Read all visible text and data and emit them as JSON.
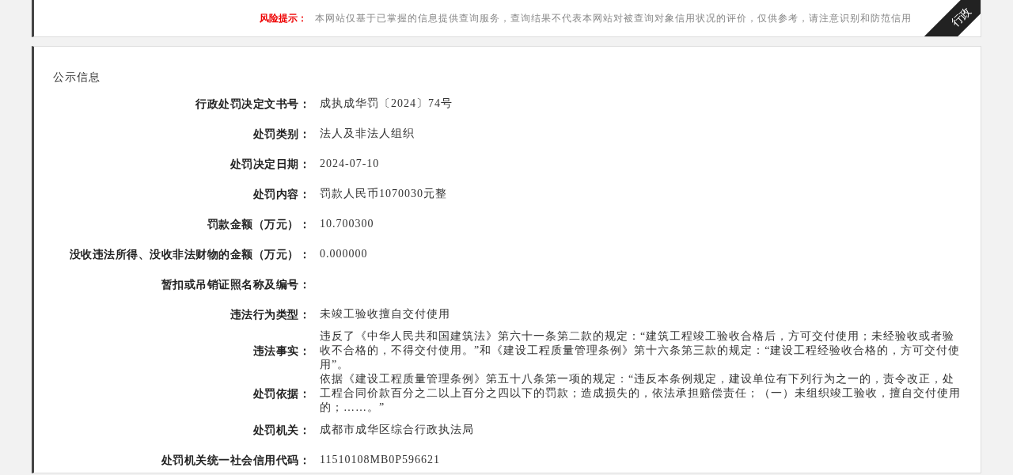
{
  "risk_notice": {
    "label": "风险提示：",
    "text": "本网站仅基于已掌握的信息提供查询服务，查询结果不代表本网站对被查询对象信用状况的评价，仅供参考，请注意识别和防范信用",
    "ribbon": "行政"
  },
  "section": {
    "title": "公示信息",
    "rows": [
      {
        "label": "行政处罚决定文书号：",
        "value": "成执成华罚〔2024〕74号"
      },
      {
        "label": "处罚类别：",
        "value": "法人及非法人组织"
      },
      {
        "label": "处罚决定日期：",
        "value": "2024-07-10"
      },
      {
        "label": "处罚内容：",
        "value": "罚款人民币1070030元整"
      },
      {
        "label": "罚款金额（万元）：",
        "value": "10.700300"
      },
      {
        "label": "没收违法所得、没收非法财物的金额（万元）：",
        "value": "0.000000"
      },
      {
        "label": "暂扣或吊销证照名称及编号："
      },
      {
        "label": "违法行为类型：",
        "value": "未竣工验收擅自交付使用"
      },
      {
        "label": "违法事实：",
        "value": "违反了《中华人民共和国建筑法》第六十一条第二款的规定：“建筑工程竣工验收合格后，方可交付使用；未经验收或者验收不合格的，不得交付使用。”和《建设工程质量管理条例》第十六条第三款的规定：“建设工程经验收合格的，方可交付使用”。"
      },
      {
        "label": "处罚依据：",
        "value": "依据《建设工程质量管理条例》第五十八条第一项的规定：“违反本条例规定，建设单位有下列行为之一的，责令改正，处工程合同价款百分之二以上百分之四以下的罚款；造成损失的，依法承担赔偿责任；（一）未组织竣工验收，擅自交付使用的；……。”"
      },
      {
        "label": "处罚机关：",
        "value": "成都市成华区综合行政执法局"
      },
      {
        "label": "处罚机关统一社会信用代码：",
        "value": "11510108MB0P596621"
      }
    ]
  }
}
